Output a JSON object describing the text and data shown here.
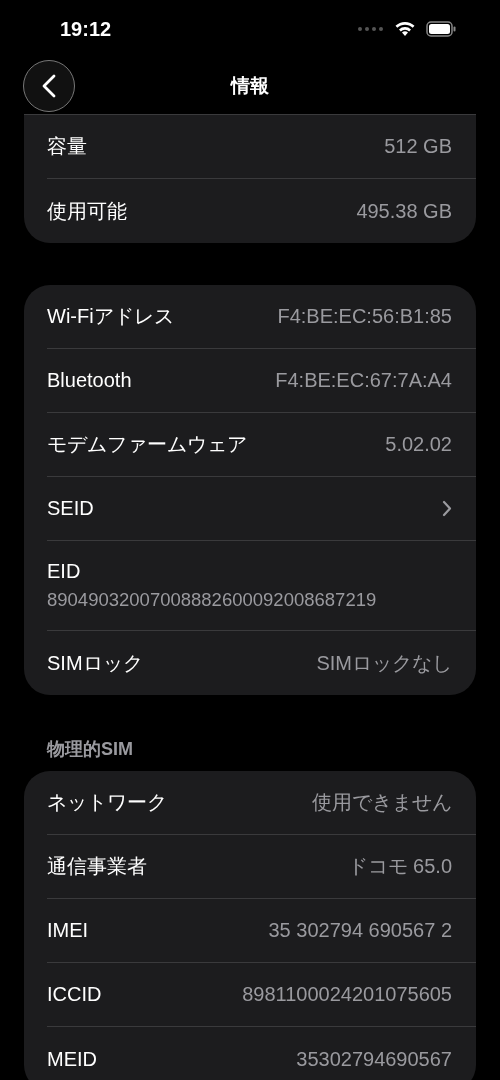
{
  "status_bar": {
    "time": "19:12"
  },
  "nav": {
    "title": "情報"
  },
  "sections": [
    {
      "rows": [
        {
          "kind": "value",
          "label": "容量",
          "value": "512 GB"
        },
        {
          "kind": "value",
          "label": "使用可能",
          "value": "495.38 GB"
        }
      ],
      "top_cut": true
    },
    {
      "rows": [
        {
          "kind": "value",
          "label": "Wi-Fiアドレス",
          "value": "F4:BE:EC:56:B1:85"
        },
        {
          "kind": "value",
          "label": "Bluetooth",
          "value": "F4:BE:EC:67:7A:A4"
        },
        {
          "kind": "value",
          "label": "モデムファームウェア",
          "value": "5.02.02"
        },
        {
          "kind": "link",
          "label": "SEID"
        },
        {
          "kind": "stacked",
          "label": "EID",
          "value": "89049032007008882600092008687219"
        },
        {
          "kind": "value",
          "label": "SIMロック",
          "value": "SIMロックなし"
        }
      ]
    },
    {
      "header": "物理的SIM",
      "rows": [
        {
          "kind": "value",
          "label": "ネットワーク",
          "value": "使用できません"
        },
        {
          "kind": "value",
          "label": "通信事業者",
          "value": "ドコモ 65.0"
        },
        {
          "kind": "value",
          "label": "IMEI",
          "value": "35 302794 690567 2"
        },
        {
          "kind": "value",
          "label": "ICCID",
          "value": "8981100024201075605"
        },
        {
          "kind": "value",
          "label": "MEID",
          "value": "35302794690567"
        }
      ]
    }
  ]
}
